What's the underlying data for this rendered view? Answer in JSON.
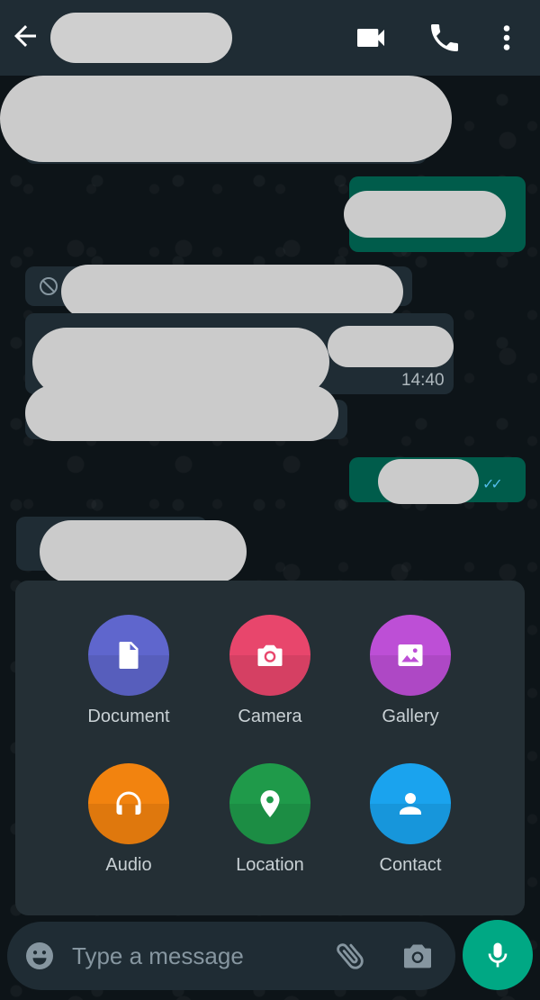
{
  "chat": {
    "messages": [
      {
        "time": "14:40"
      }
    ]
  },
  "attach_menu": {
    "items": [
      {
        "label": "Document",
        "color": "#5f66cd",
        "icon": "document-icon"
      },
      {
        "label": "Camera",
        "color": "#e8466c",
        "icon": "camera-icon"
      },
      {
        "label": "Gallery",
        "color": "#bd4fd6",
        "icon": "gallery-icon"
      },
      {
        "label": "Audio",
        "color": "#f2830f",
        "icon": "headphones-icon"
      },
      {
        "label": "Location",
        "color": "#1f9a4a",
        "icon": "location-pin-icon"
      },
      {
        "label": "Contact",
        "color": "#1aa3ee",
        "icon": "contact-person-icon"
      }
    ]
  },
  "composer": {
    "placeholder": "Type a message"
  },
  "colors": {
    "header": "#1f2c34",
    "accent": "#00a884",
    "outgoing_bubble": "#005c4b",
    "incoming_bubble": "#1f2c34",
    "read_ticks": "#53bdeb"
  }
}
